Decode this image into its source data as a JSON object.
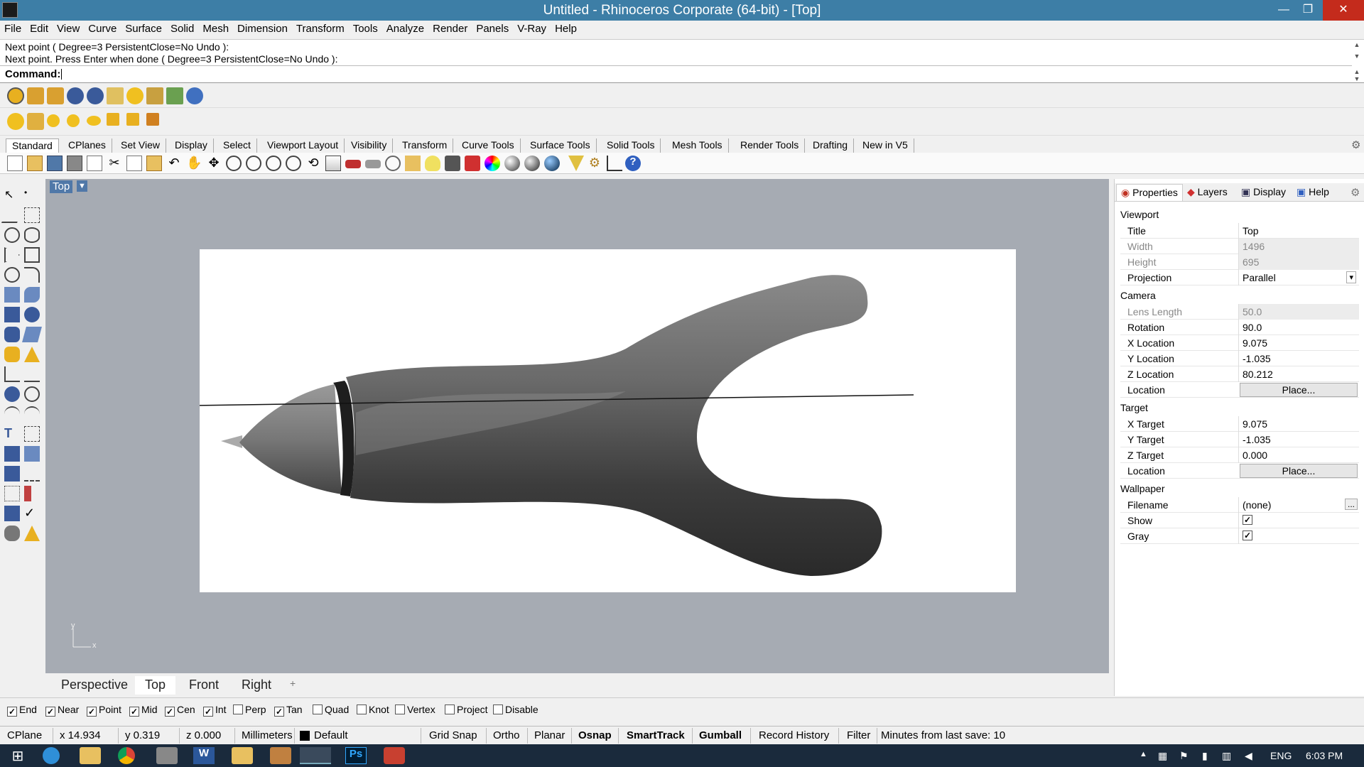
{
  "window": {
    "title": "Untitled - Rhinoceros Corporate (64-bit) - [Top]",
    "minimize": "—",
    "restore": "❐",
    "close": "✕"
  },
  "menu": [
    "File",
    "Edit",
    "View",
    "Curve",
    "Surface",
    "Solid",
    "Mesh",
    "Dimension",
    "Transform",
    "Tools",
    "Analyze",
    "Render",
    "Panels",
    "V-Ray",
    "Help"
  ],
  "command": {
    "history": [
      "Next point ( Degree=3  PersistentClose=No  Undo ):",
      "Next point. Press Enter when done ( Degree=3  PersistentClose=No  Undo ):"
    ],
    "prompt": "Command:",
    "value": ""
  },
  "toolbar_tabs": [
    "Standard",
    "CPlanes",
    "Set View",
    "Display",
    "Select",
    "Viewport Layout",
    "Visibility",
    "Transform",
    "Curve Tools",
    "Surface Tools",
    "Solid Tools",
    "Mesh Tools",
    "Render Tools",
    "Drafting",
    "New in V5"
  ],
  "active_toolbar_tab": "Standard",
  "viewport": {
    "title": "Top",
    "axis_y": "y",
    "axis_x": "x"
  },
  "viewport_tabs": [
    "Perspective",
    "Top",
    "Front",
    "Right"
  ],
  "active_viewport_tab": "Top",
  "add_viewport": "+",
  "osnaps": [
    {
      "label": "End",
      "checked": true
    },
    {
      "label": "Near",
      "checked": true
    },
    {
      "label": "Point",
      "checked": true
    },
    {
      "label": "Mid",
      "checked": true
    },
    {
      "label": "Cen",
      "checked": true
    },
    {
      "label": "Int",
      "checked": true
    },
    {
      "label": "Perp",
      "checked": false
    },
    {
      "label": "Tan",
      "checked": true
    },
    {
      "label": "Quad",
      "checked": false
    },
    {
      "label": "Knot",
      "checked": false
    },
    {
      "label": "Vertex",
      "checked": false
    },
    {
      "label": "Project",
      "checked": false
    },
    {
      "label": "Disable",
      "checked": false
    }
  ],
  "status": {
    "cplane": "CPlane",
    "x": "x 14.934",
    "y": "y 0.319",
    "z": "z 0.000",
    "units": "Millimeters",
    "layer": "Default",
    "layer_color": "#000000",
    "grid_snap": "Grid Snap",
    "ortho": "Ortho",
    "planar": "Planar",
    "osnap": "Osnap",
    "smarttrack": "SmartTrack",
    "gumball": "Gumball",
    "record_history": "Record History",
    "filter": "Filter",
    "save_info": "Minutes from last save: 10"
  },
  "panel": {
    "tabs": [
      "Properties",
      "Layers",
      "Display",
      "Help"
    ],
    "active_tab": "Properties",
    "sections": {
      "viewport": "Viewport",
      "camera": "Camera",
      "target": "Target",
      "wallpaper": "Wallpaper"
    },
    "viewport_props": {
      "title_label": "Title",
      "title": "Top",
      "width_label": "Width",
      "width": "1496",
      "height_label": "Height",
      "height": "695",
      "projection_label": "Projection",
      "projection": "Parallel"
    },
    "camera_props": {
      "lens_label": "Lens Length",
      "lens": "50.0",
      "rotation_label": "Rotation",
      "rotation": "90.0",
      "xloc_label": "X Location",
      "xloc": "9.075",
      "yloc_label": "Y Location",
      "yloc": "-1.035",
      "zloc_label": "Z Location",
      "zloc": "80.212",
      "location_label": "Location",
      "place": "Place..."
    },
    "target_props": {
      "xt_label": "X Target",
      "xt": "9.075",
      "yt_label": "Y Target",
      "yt": "-1.035",
      "zt_label": "Z Target",
      "zt": "0.000",
      "location_label": "Location",
      "place": "Place..."
    },
    "wallpaper_props": {
      "filename_label": "Filename",
      "filename": "(none)",
      "browse": "...",
      "show_label": "Show",
      "show": true,
      "gray_label": "Gray",
      "gray": true
    }
  },
  "taskbar": {
    "lang": "ENG",
    "time": "6:03 PM"
  },
  "colors": {
    "titlebar": "#3d7ea6",
    "viewport_bg": "#a6abb3",
    "taskbar": "#1a2a3c",
    "close": "#c42b1c"
  }
}
